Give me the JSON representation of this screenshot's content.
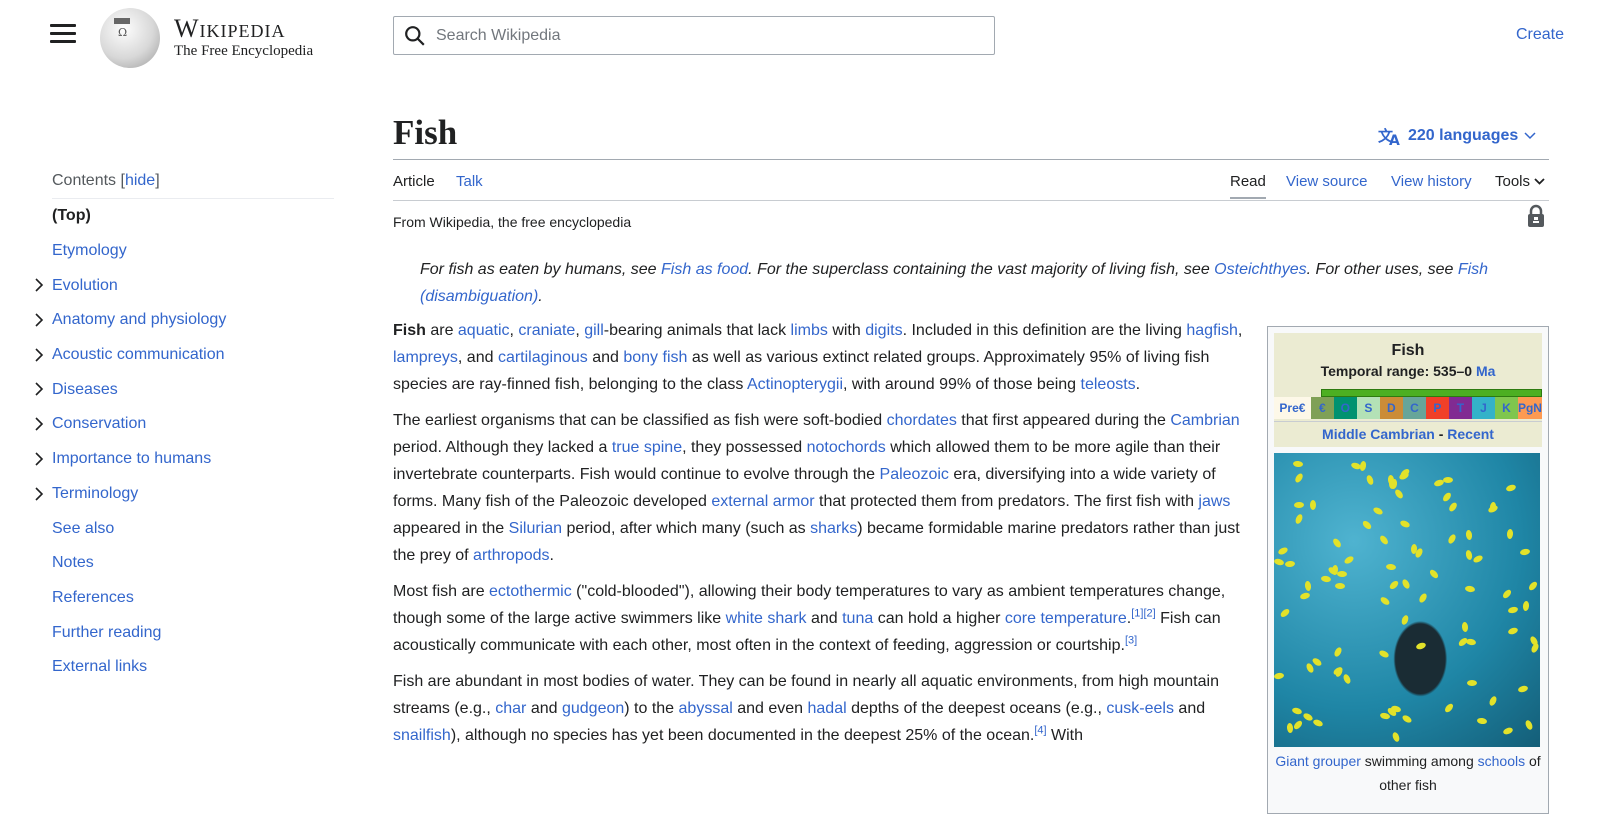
{
  "header": {
    "wordmark": "Wikipedia",
    "tagline": "The Free Encyclopedia",
    "search_placeholder": "Search Wikipedia",
    "create_label": "Create"
  },
  "toc": {
    "heading": "Contents",
    "hide_label": "hide",
    "items": [
      {
        "label": "(Top)",
        "expandable": false
      },
      {
        "label": "Etymology",
        "expandable": false
      },
      {
        "label": "Evolution",
        "expandable": true
      },
      {
        "label": "Anatomy and physiology",
        "expandable": true
      },
      {
        "label": "Acoustic communication",
        "expandable": true
      },
      {
        "label": "Diseases",
        "expandable": true
      },
      {
        "label": "Conservation",
        "expandable": true
      },
      {
        "label": "Importance to humans",
        "expandable": true
      },
      {
        "label": "Terminology",
        "expandable": true
      },
      {
        "label": "See also",
        "expandable": false
      },
      {
        "label": "Notes",
        "expandable": false
      },
      {
        "label": "References",
        "expandable": false
      },
      {
        "label": "Further reading",
        "expandable": false
      },
      {
        "label": "External links",
        "expandable": false
      }
    ]
  },
  "article": {
    "title": "Fish",
    "languages": "220 languages",
    "tabs": {
      "article": "Article",
      "talk": "Talk",
      "read": "Read",
      "view_source": "View source",
      "view_history": "View history",
      "tools": "Tools"
    },
    "from": "From Wikipedia, the free encyclopedia",
    "hatnote": {
      "t1": "For fish as eaten by humans, see ",
      "l1": "Fish as food",
      "t2": ". For the superclass containing the vast majority of living fish, see ",
      "l2": "Osteichthyes",
      "t3": ". For other uses, see ",
      "l3": "Fish (disambiguation)",
      "t4": "."
    },
    "paragraphs": [
      [
        {
          "b": "Fish"
        },
        {
          "t": " are "
        },
        {
          "l": "aquatic"
        },
        {
          "t": ", "
        },
        {
          "l": "craniate"
        },
        {
          "t": ", "
        },
        {
          "l": "gill"
        },
        {
          "t": "-bearing animals that lack "
        },
        {
          "l": "limbs"
        },
        {
          "t": " with "
        },
        {
          "l": "digits"
        },
        {
          "t": ". Included in this definition are the living "
        },
        {
          "l": "hagfish"
        },
        {
          "t": ", "
        },
        {
          "l": "lampreys"
        },
        {
          "t": ", and "
        },
        {
          "l": "cartilaginous"
        },
        {
          "t": " and "
        },
        {
          "l": "bony fish"
        },
        {
          "t": " as well as various extinct related groups. Approximately 95% of living fish species are ray-finned fish, belonging to the class "
        },
        {
          "l": "Actinopterygii"
        },
        {
          "t": ", with around 99% of those being "
        },
        {
          "l": "teleosts"
        },
        {
          "t": "."
        }
      ],
      [
        {
          "t": "The earliest organisms that can be classified as fish were soft-bodied "
        },
        {
          "l": "chordates"
        },
        {
          "t": " that first appeared during the "
        },
        {
          "l": "Cambrian"
        },
        {
          "t": " period. Although they lacked a "
        },
        {
          "l": "true spine"
        },
        {
          "t": ", they possessed "
        },
        {
          "l": "notochords"
        },
        {
          "t": " which allowed them to be more agile than their invertebrate counterparts. Fish would continue to evolve through the "
        },
        {
          "l": "Paleozoic"
        },
        {
          "t": " era, diversifying into a wide variety of forms. Many fish of the Paleozoic developed "
        },
        {
          "l": "external armor"
        },
        {
          "t": " that protected them from predators. The first fish with "
        },
        {
          "l": "jaws"
        },
        {
          "t": " appeared in the "
        },
        {
          "l": "Silurian"
        },
        {
          "t": " period, after which many (such as "
        },
        {
          "l": "sharks"
        },
        {
          "t": ") became formidable marine predators rather than just the prey of "
        },
        {
          "l": "arthropods"
        },
        {
          "t": "."
        }
      ],
      [
        {
          "t": "Most fish are "
        },
        {
          "l": "ectothermic"
        },
        {
          "t": " (\"cold-blooded\"), allowing their body temperatures to vary as ambient temperatures change, though some of the large active swimmers like "
        },
        {
          "l": "white shark"
        },
        {
          "t": " and "
        },
        {
          "l": "tuna"
        },
        {
          "t": " can hold a higher "
        },
        {
          "l": "core temperature"
        },
        {
          "t": "."
        },
        {
          "s": "[1]"
        },
        {
          "s": "[2]"
        },
        {
          "t": " Fish can acoustically communicate with each other, most often in the context of feeding, aggression or courtship."
        },
        {
          "s": "[3]"
        }
      ],
      [
        {
          "t": "Fish are abundant in most bodies of water. They can be found in nearly all aquatic environments, from high mountain streams (e.g., "
        },
        {
          "l": "char"
        },
        {
          "t": " and "
        },
        {
          "l": "gudgeon"
        },
        {
          "t": ") to the "
        },
        {
          "l": "abyssal"
        },
        {
          "t": " and even "
        },
        {
          "l": "hadal"
        },
        {
          "t": " depths of the deepest oceans (e.g., "
        },
        {
          "l": "cusk-eels"
        },
        {
          "t": " and "
        },
        {
          "l": "snailfish"
        },
        {
          "t": "), although no species has yet been documented in the deepest 25% of the ocean."
        },
        {
          "s": "[4]"
        },
        {
          "t": " With"
        }
      ]
    ]
  },
  "infobox": {
    "title": "Fish",
    "range_label": "Temporal range: 535–0 ",
    "range_unit": "Ma",
    "periods": [
      {
        "label": "Pre€",
        "color": "#fdf8e8"
      },
      {
        "label": "€",
        "color": "#7fa056"
      },
      {
        "label": "O",
        "color": "#009270"
      },
      {
        "label": "S",
        "color": "#b3e1b6"
      },
      {
        "label": "D",
        "color": "#cb8c37"
      },
      {
        "label": "C",
        "color": "#67a599"
      },
      {
        "label": "P",
        "color": "#f04028"
      },
      {
        "label": "T",
        "color": "#812b92"
      },
      {
        "label": "J",
        "color": "#34b2c9"
      },
      {
        "label": "K",
        "color": "#7fc64e"
      },
      {
        "label": "PgN",
        "color": "#fd9a52"
      }
    ],
    "span_start": "Middle Cambrian",
    "span_sep": " - ",
    "span_end": "Recent",
    "caption_link1": "Giant grouper",
    "caption_text": " swimming among ",
    "caption_link2": "schools",
    "caption_text2": " of other fish"
  }
}
